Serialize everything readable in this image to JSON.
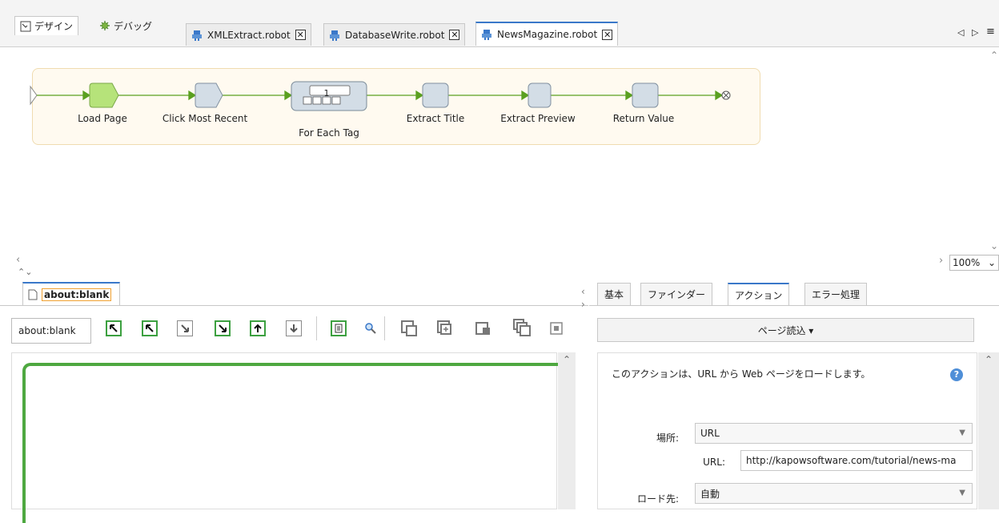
{
  "mode_tabs": [
    {
      "label": "デザイン",
      "icon": "design-icon"
    },
    {
      "label": "デバッグ",
      "icon": "debug-icon"
    }
  ],
  "doc_tabs": [
    {
      "label": "XMLExtract.robot",
      "icon": "robot-icon"
    },
    {
      "label": "DatabaseWrite.robot",
      "icon": "robot-icon"
    },
    {
      "label": "NewsMagazine.robot",
      "icon": "robot-icon",
      "selected": true
    }
  ],
  "tab_nav": {
    "prev": "◁",
    "next": "▷",
    "list": "≡"
  },
  "flow": {
    "steps": [
      {
        "label": "Load Page",
        "color": "#b6e37a"
      },
      {
        "label": "Click Most Recent",
        "color": "#d3dde6"
      },
      {
        "label": "For Each Tag",
        "color": "#d3dde6",
        "counter": "1"
      },
      {
        "label": "Extract Title",
        "color": "#d3dde6"
      },
      {
        "label": "Extract Preview",
        "color": "#d3dde6"
      },
      {
        "label": "Return Value",
        "color": "#d3dde6"
      }
    ],
    "end_symbol": "⊗"
  },
  "zoom": {
    "value": "100%"
  },
  "browser": {
    "tab_title": "about:blank",
    "address": "about:blank"
  },
  "toolbar_icons": [
    "select-up-left-icon",
    "select-up-icon",
    "select-down-right-icon",
    "select-down-icon",
    "select-parent-icon",
    "select-child-icon",
    "view-source-icon",
    "search-icon",
    "window-icon-1",
    "window-icon-2",
    "window-icon-3",
    "window-icon-4",
    "window-icon-5"
  ],
  "props": {
    "tabs": [
      "基本",
      "ファインダー",
      "アクション",
      "エラー処理"
    ],
    "selected_tab": "アクション",
    "action_dropdown": "ページ読込 ▾",
    "description": "このアクションは、URL から Web ページをロードします。",
    "location_label": "場所:",
    "location_value": "URL",
    "url_label": "URL:",
    "url_value": "http://kapowsoftware.com/tutorial/news-ma",
    "load_to_label": "ロード先:",
    "load_to_value": "自動"
  },
  "colors": {
    "accent": "#3a78c9",
    "flow_green": "#5aa020",
    "box_green": "#3ca040"
  }
}
